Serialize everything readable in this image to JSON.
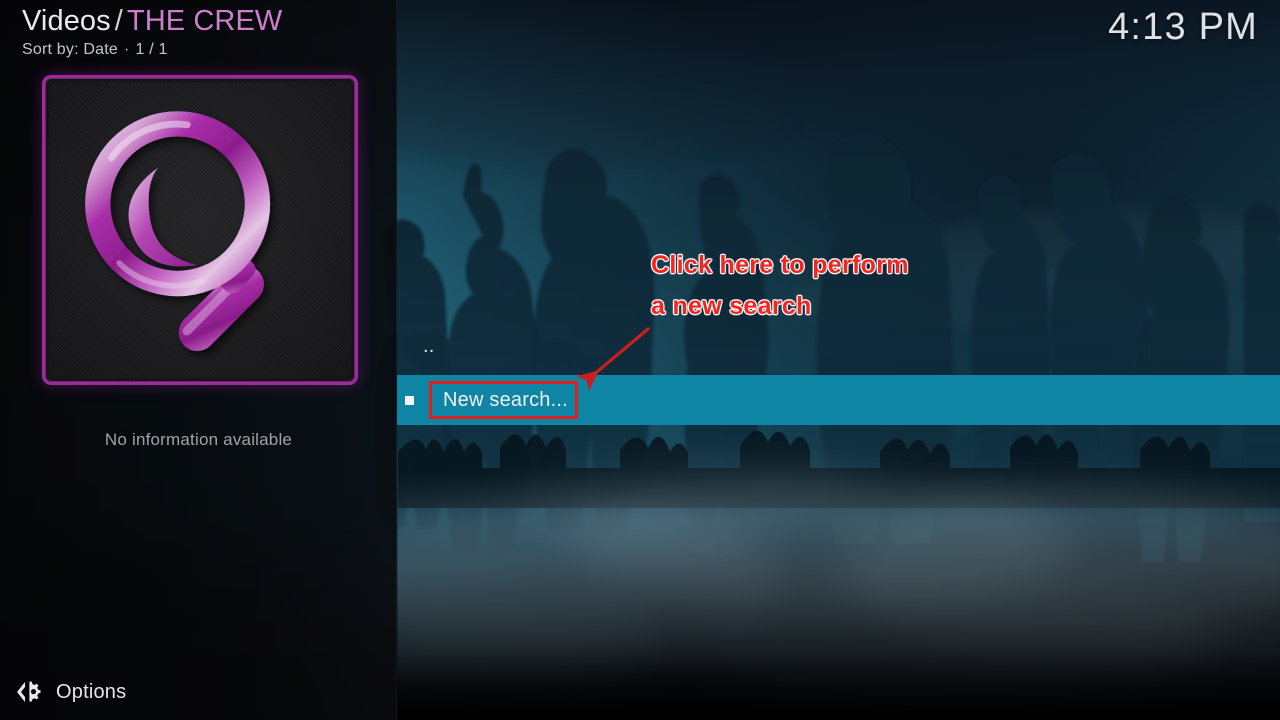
{
  "header": {
    "section": "Videos",
    "separator": "/",
    "folder": "THE CREW",
    "sort_label": "Sort by: Date",
    "sort_separator": "·",
    "page_indicator": "1 / 1",
    "accent_color": "#cd7ecd"
  },
  "clock": {
    "time": "4:13 PM"
  },
  "info_panel": {
    "thumbnail_icon": "magnifier-icon",
    "plot_text": "No information available",
    "thumb_border_color": "#9d2b9d",
    "thumb_icon_color": "#b030b0"
  },
  "footer": {
    "options_icon": "options-gear-icon",
    "options_label": "Options"
  },
  "file_list": {
    "highlight_color": "#0f85a5",
    "items": [
      {
        "label": "..",
        "name": "parent-folder",
        "selected": false,
        "bullet": false
      },
      {
        "label": "New search...",
        "name": "new-search",
        "selected": true,
        "bullet": true
      }
    ]
  },
  "annotation": {
    "line1": "Click here to perform",
    "line2": "a new search",
    "color": "#f5241f",
    "box_color": "#e0201c",
    "arrow": "red-arrow-down-left"
  }
}
